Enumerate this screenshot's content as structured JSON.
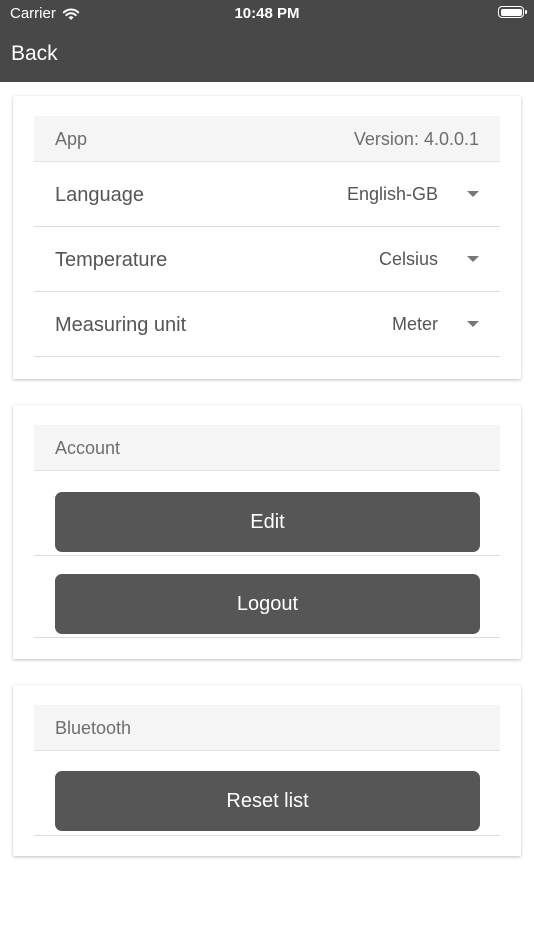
{
  "status_bar": {
    "carrier": "Carrier",
    "time": "10:48 PM",
    "wifi_icon": "wifi-icon",
    "battery_icon": "battery-icon"
  },
  "nav": {
    "back_label": "Back"
  },
  "app_section": {
    "title": "App",
    "version": "Version: 4.0.0.1",
    "rows": [
      {
        "label": "Language",
        "value": "English-GB"
      },
      {
        "label": "Temperature",
        "value": "Celsius"
      },
      {
        "label": "Measuring unit",
        "value": "Meter"
      }
    ]
  },
  "account_section": {
    "title": "Account",
    "edit_label": "Edit",
    "logout_label": "Logout"
  },
  "bluetooth_section": {
    "title": "Bluetooth",
    "reset_label": "Reset list"
  },
  "colors": {
    "topbar": "#484848",
    "button": "#565656",
    "header_bg": "#f5f5f5"
  }
}
